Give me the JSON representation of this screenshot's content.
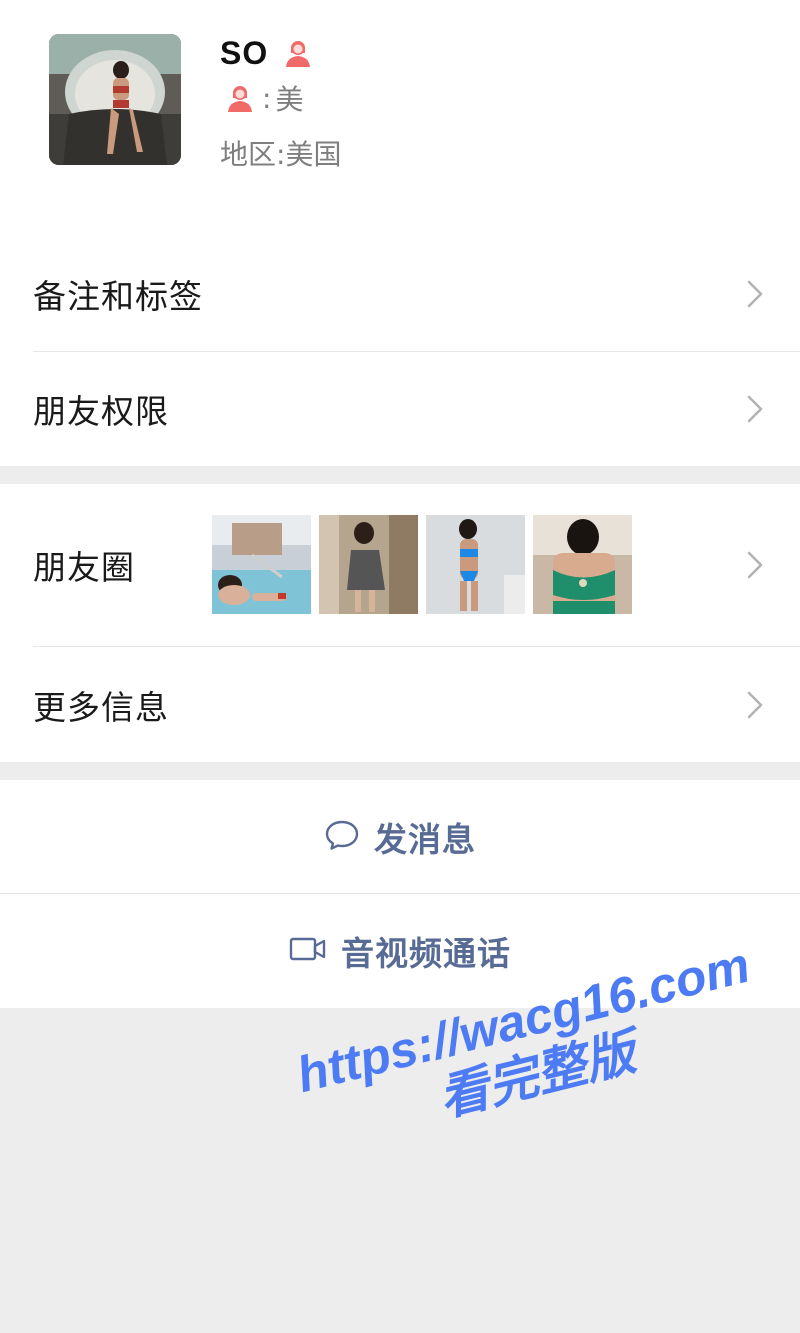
{
  "profile": {
    "nickname": "SO",
    "wxid_prefix": ":",
    "wxid_value": "美",
    "region_label": "地区:",
    "region_value": "美国"
  },
  "menu": {
    "remark_tags": "备注和标签",
    "friend_permissions": "朋友权限",
    "moments": "朋友圈",
    "more_info": "更多信息"
  },
  "actions": {
    "send_message": "发消息",
    "video_call": "音视频通话"
  },
  "watermark": {
    "url": "https://wacg16.com",
    "text": "看完整版"
  },
  "colors": {
    "link_blue": "#576b95",
    "female_icon": "#f06a6a",
    "watermark": "#4d7bf3",
    "background": "#ededed"
  },
  "icons": {
    "gender": "female-person-icon",
    "chevron": "chevron-right-icon",
    "message": "speech-bubble-icon",
    "video": "video-camera-icon"
  }
}
